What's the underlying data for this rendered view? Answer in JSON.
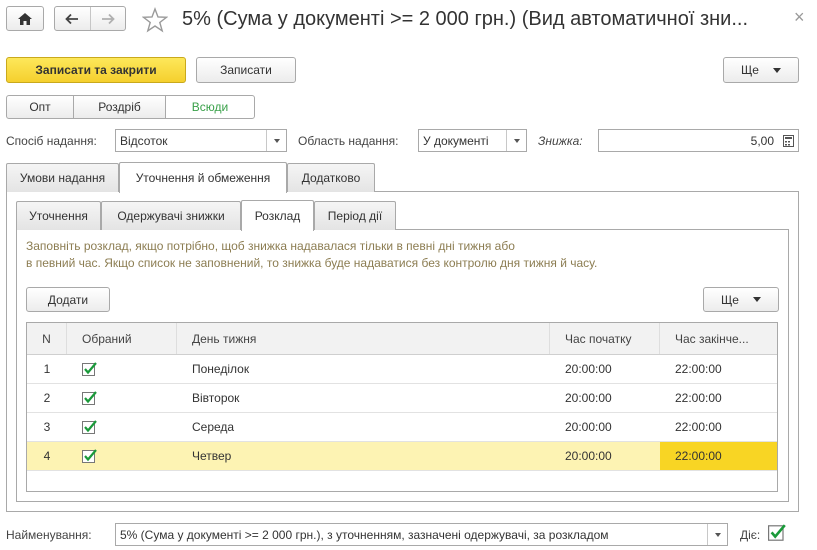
{
  "window": {
    "title": "5% (Сума у документі >= 2 000 грн.) (Вид автоматичної зни...",
    "close_glyph": "×"
  },
  "toolbar": {
    "save_close_label": "Записати та закрити",
    "save_label": "Записати",
    "more_label": "Ще"
  },
  "modes": [
    "Опт",
    "Роздріб",
    "Всюди"
  ],
  "form": {
    "method_label": "Спосіб надання:",
    "method_value": "Відсоток",
    "area_label": "Область надання:",
    "area_value": "У документі",
    "discount_label": "Знижка:",
    "discount_value": "5,00"
  },
  "main_tabs": [
    "Умови надання",
    "Уточнення й обмеження",
    "Додатково"
  ],
  "sub_tabs": [
    "Уточнення",
    "Одержувачі знижки",
    "Розклад",
    "Період дії"
  ],
  "schedule": {
    "hint_line1": "Заповніть розклад, якщо потрібно, щоб знижка надавалася тільки в певні дні тижня або",
    "hint_line2": "в певний час. Якщо список не заповнений, то знижка буде надаватися без контролю дня тижня й часу.",
    "add_label": "Додати",
    "more_label": "Ще",
    "columns": [
      "N",
      "Обраний",
      "День тижня",
      "Час початку",
      "Час закінче..."
    ],
    "rows": [
      {
        "n": "1",
        "selected": true,
        "day": "Понеділок",
        "start": "20:00:00",
        "end": "22:00:00"
      },
      {
        "n": "2",
        "selected": true,
        "day": "Вівторок",
        "start": "20:00:00",
        "end": "22:00:00"
      },
      {
        "n": "3",
        "selected": true,
        "day": "Середа",
        "start": "20:00:00",
        "end": "22:00:00"
      },
      {
        "n": "4",
        "selected": true,
        "day": "Четвер",
        "start": "20:00:00",
        "end": "22:00:00"
      }
    ]
  },
  "footer": {
    "name_label": "Найменування:",
    "name_value": "5% (Сума у документі >= 2 000 грн.), з уточненням, зазначені одержувачі, за розкладом",
    "active_label": "Діє:"
  },
  "colors": {
    "accent_yellow": "#f5d02e",
    "selected_row": "#fdf3b3",
    "selected_cell": "#f8d524",
    "check_green": "#1a9a3a",
    "hint_text": "#8c7d52",
    "active_mode_text": "#3aa14a"
  }
}
